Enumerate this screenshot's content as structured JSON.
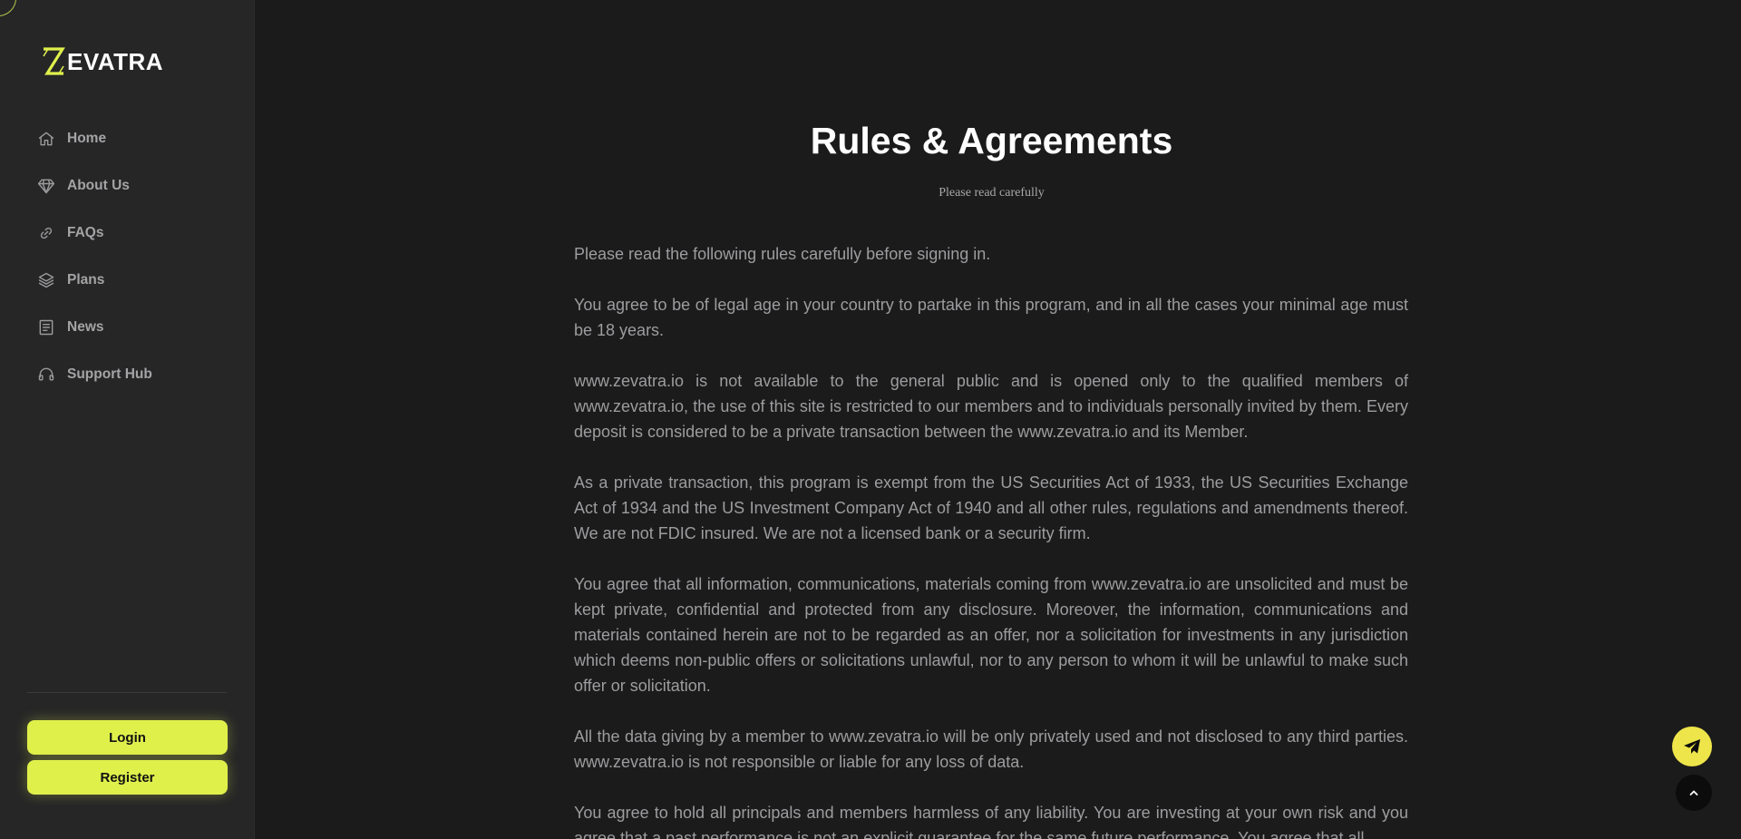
{
  "brand": {
    "logo_text": "EVATRA",
    "accent_color": "#dff04b"
  },
  "sidebar": {
    "items": [
      {
        "label": "Home",
        "icon": "home-icon"
      },
      {
        "label": "About Us",
        "icon": "diamond-icon"
      },
      {
        "label": "FAQs",
        "icon": "link-icon"
      },
      {
        "label": "Plans",
        "icon": "layers-icon"
      },
      {
        "label": "News",
        "icon": "newspaper-icon"
      },
      {
        "label": "Support Hub",
        "icon": "headset-icon"
      }
    ],
    "login_label": "Login",
    "register_label": "Register"
  },
  "main": {
    "title": "Rules & Agreements",
    "subtitle": "Please read carefully",
    "paragraphs": [
      "Please read the following rules carefully before signing in.",
      "You agree to be of legal age in your country to partake in this program, and in all the cases your minimal age must be 18 years.",
      "www.zevatra.io is not available to the general public and is opened only to the qualified members of www.zevatra.io, the use of this site is restricted to our members and to individuals personally invited by them. Every deposit is considered to be a private transaction between the www.zevatra.io and its Member.",
      "As a private transaction, this program is exempt from the US Securities Act of 1933, the US Securities Exchange Act of 1934 and the US Investment Company Act of 1940 and all other rules, regulations and amendments thereof. We are not FDIC insured. We are not a licensed bank or a security firm.",
      "You agree that all information, communications, materials coming from www.zevatra.io are unsolicited and must be kept private, confidential and protected from any disclosure. Moreover, the information, communications and materials contained herein are not to be regarded as an offer, nor a solicitation for investments in any jurisdiction which deems non-public offers or solicitations unlawful, nor to any person to whom it will be unlawful to make such offer or solicitation.",
      "All the data giving by a member to www.zevatra.io will be only privately used and not disclosed to any third parties. www.zevatra.io is not responsible or liable for any loss of data.",
      "You agree to hold all principals and members harmless of any liability. You are investing at your own risk and you agree that a past performance is not an explicit guarantee for the same future performance. You agree that all"
    ]
  },
  "floating": {
    "telegram_icon": "telegram-icon",
    "scroll_top_icon": "chevron-up-icon",
    "telegram_color": "#eee54a"
  }
}
